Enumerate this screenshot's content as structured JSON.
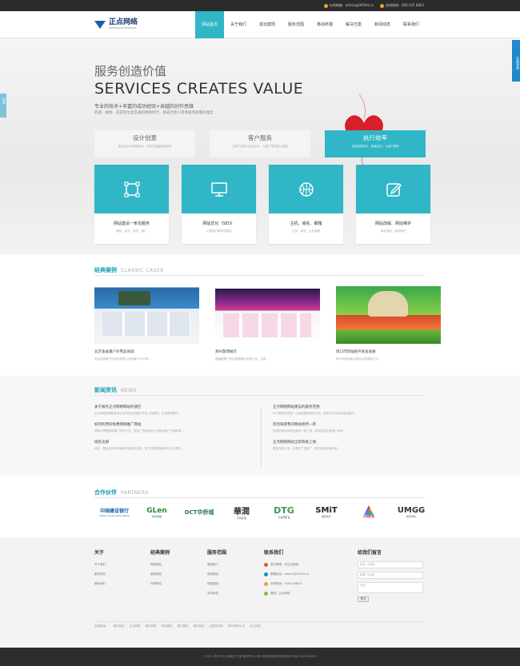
{
  "topbar": {
    "email": "在线邮箱：admin@00594.cn",
    "hotline": "咨询热线：400 025 8803"
  },
  "logo": {
    "name": "正点网络",
    "sub": "ZHENGDIAN NETWORK"
  },
  "nav": [
    "网站首页",
    "关于我们",
    "成功案例",
    "服务范围",
    "移动终端",
    "解决方案",
    "新闻动态",
    "联系我们"
  ],
  "side_right": "在线咨询",
  "side_left": "分享",
  "hero": {
    "cn": "服务创造价值",
    "en": "SERVICES CREATES VALUE",
    "sub1": "专业的技术+丰富的成功经验+卓越的创作思维",
    "sub2": "机遇、敏锐、追求新生意互通的网络时代，搞成为客户提供服务质量的理念"
  },
  "services": [
    {
      "title": "设计创意",
      "desc": "整合设计与网络技术，为您打造高品质网站",
      "active": false
    },
    {
      "title": "客户服务",
      "desc": "注重产品的人性化设计，为客户提供贴心服务",
      "active": false
    },
    {
      "title": "执行效率",
      "desc": "全程高效执行，快速交付，让客户满意",
      "active": true
    }
  ],
  "cards": [
    {
      "title": "网站建设一条龙服务",
      "desc": "策划、设计、制作、推广",
      "icon": "crop-icon"
    },
    {
      "title": "网站优化（SEO）",
      "desc": "让搜索引擎排名靠前",
      "icon": "monitor-icon"
    },
    {
      "title": "主机、域名、邮箱",
      "desc": "主机、域名、企业邮箱",
      "icon": "basketball-icon"
    },
    {
      "title": "网站改版、网站维护",
      "desc": "网站改版、网站维护",
      "icon": "edit-icon"
    }
  ],
  "cases_section": {
    "cn": "经典案例",
    "en": "CLASSIC CASES"
  },
  "cases": [
    {
      "title": "北京金泰康户外用品商城",
      "desc": "北京金泰康户外用品有限公司创建于2009年..."
    },
    {
      "title": "郑州暨博展示",
      "desc": "国播暨展于郑州暨展展示有限公司，主要..."
    },
    {
      "title": "周口市新陆春开发会发展",
      "desc": "周口市新陆春以推动与发展致力于..."
    }
  ],
  "news_section": {
    "cn": "新闻资讯",
    "en": "NEWS"
  },
  "news_left": [
    {
      "title": "关于服务正点网络网站的通告",
      "desc": "正点网络依据新技术企业网站定制建设开发上线管理，实现最快服务..."
    },
    {
      "title": "如何利用好免费网络推广网站",
      "desc": "搜索引擎是网络推广的好方法，投放广告费用投入在网站推广方面效果..."
    },
    {
      "title": "域名注册",
      "desc": "域名，是由英文字母和数字组成的名称，用于在数据传输时标识计算机..."
    }
  ],
  "news_right": [
    {
      "title": "正点网络网站建设的服务范围",
      "desc": "什么是服务范围？以网站建设服务为例，通常行业内包含网站建设..."
    },
    {
      "title": "热烈祝贺我司网站焕然一新",
      "desc": "热烈祝贺我司网站焕然一新上线，新网站更注重用户体验..."
    },
    {
      "title": "正点网络网站全新改版上线",
      "desc": "整站改版上线，主要有广告推广，网站功能全面升级..."
    }
  ],
  "partners_section": {
    "cn": "合作伙伴",
    "en": "PARTNERS"
  },
  "partners": [
    {
      "name": "中国建设银行",
      "sub": "China Construction Bank",
      "color": "#1a5fa8"
    },
    {
      "name": "GLen",
      "sub": "格林电器",
      "color": "#2a8a3a"
    },
    {
      "name": "OCT华侨城",
      "sub": "",
      "color": "#2a7a4a"
    },
    {
      "name": "華潤",
      "sub": "华润集团",
      "color": "#333333"
    },
    {
      "name": "DTG",
      "sub": "大台河矿业",
      "color": "#3a9a4a"
    },
    {
      "name": "SMiT",
      "sub": "国民技术",
      "color": "#222222"
    },
    {
      "name": "长城影视",
      "sub": "",
      "color": "#c03a7a"
    },
    {
      "name": "UMGG",
      "sub": "联邦家私",
      "color": "#333333"
    }
  ],
  "footer": {
    "about": {
      "head": "关于",
      "links": [
        "关于我们",
        "服务项目",
        "联系我们"
      ]
    },
    "cases": {
      "head": "经典案例",
      "links": [
        "商城网站",
        "营销网站",
        "外贸网站"
      ]
    },
    "services": {
      "head": "服务范围",
      "links": [
        "营销推广",
        "网站建设",
        "网站建设",
        "手机网站"
      ]
    },
    "contact": {
      "head": "联系我们",
      "items": [
        {
          "text": "官方微博：@正点网络",
          "color": "#e8532a"
        },
        {
          "text": "邮箱地址：admin@00594.cn",
          "color": "#1d8acb"
        },
        {
          "text": "咨询热线：4000258803",
          "color": "#e8a23a"
        },
        {
          "text": "微信：正点网络",
          "color": "#7ac143"
        }
      ]
    },
    "form": {
      "head": "给我们留言",
      "name": "姓名（必填）",
      "email": "邮箱（必填）",
      "content": "内容",
      "submit": "提交"
    },
    "friend_links": [
      "友情链接：",
      "周口网站",
      "正点网络",
      "周口网络",
      "网站建设",
      "周口建站",
      "周口网站",
      "云服务网站",
      "周口网络公司",
      "企业网站"
    ],
    "copyright": "©2015 周口市正点网络工作室 版权所有 | 周口网站建设|周口网站制作 电话:4000258803"
  }
}
